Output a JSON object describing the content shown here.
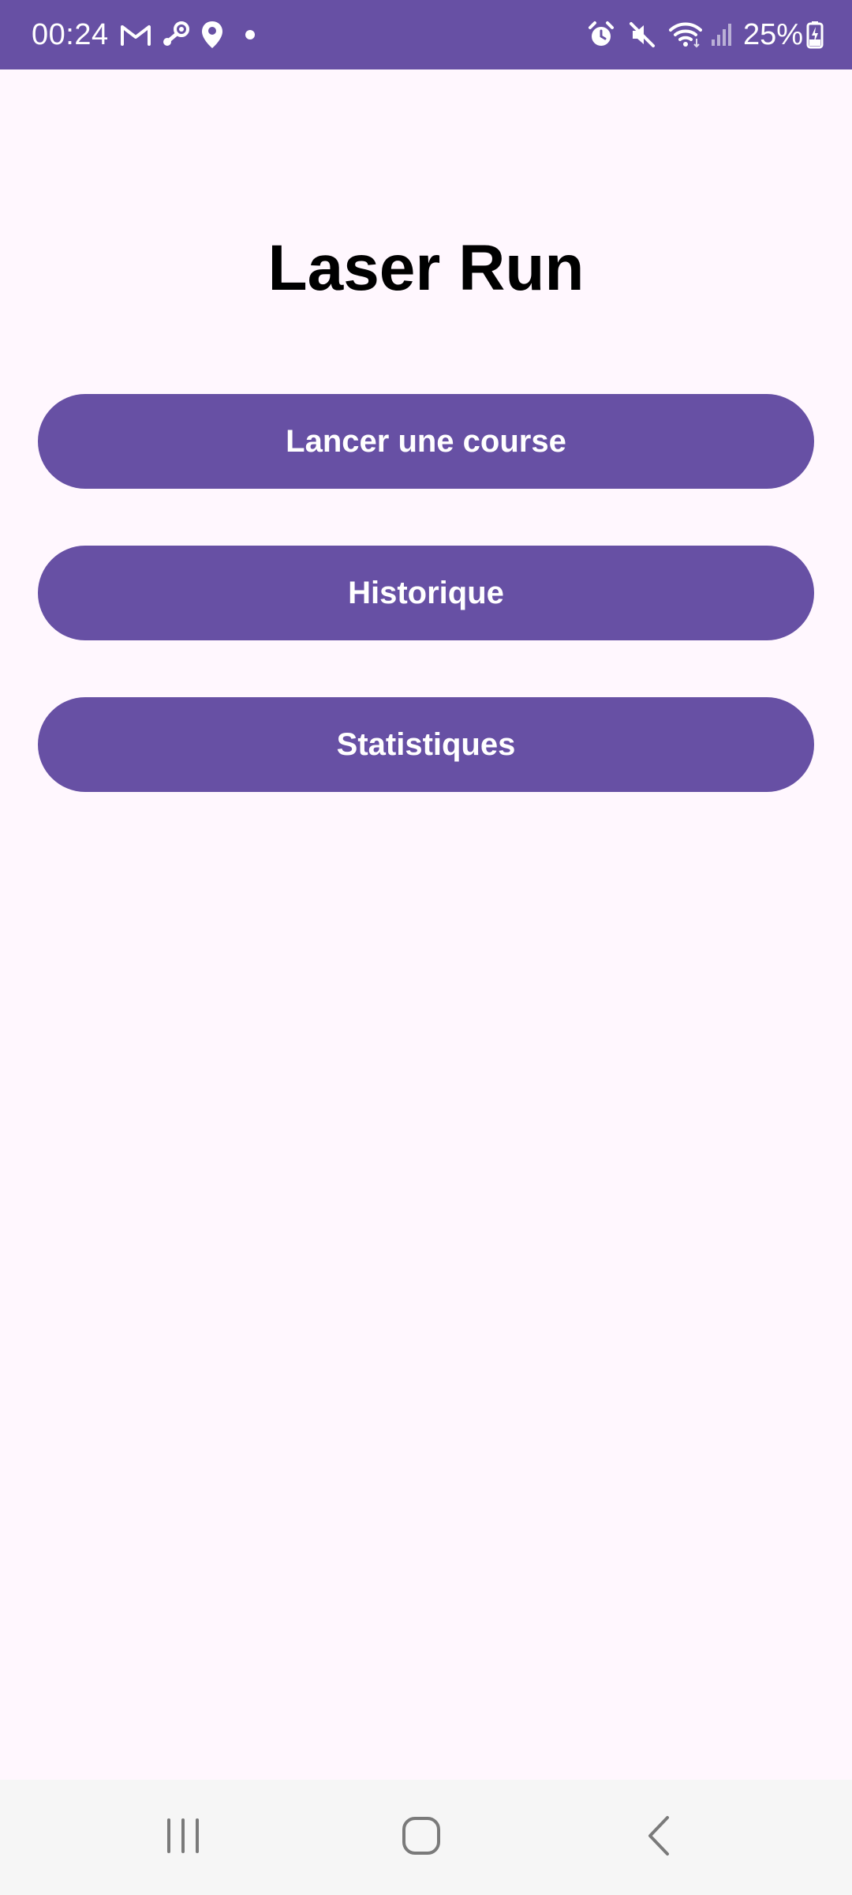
{
  "status_bar": {
    "time": "00:24",
    "battery_percent": "25%",
    "background_color": "#6750A4",
    "left_icons": [
      "gmail-icon",
      "steam-icon",
      "location-pin-icon",
      "notification-dot-icon"
    ],
    "right_icons": [
      "alarm-icon",
      "mute-icon",
      "wifi-icon",
      "cellular-signal-icon",
      "battery-charging-icon"
    ]
  },
  "app": {
    "title": "Laser Run",
    "background_color": "#FFF7FE",
    "accent_color": "#6750A4"
  },
  "menu": {
    "buttons": [
      {
        "label": "Lancer une course"
      },
      {
        "label": "Historique"
      },
      {
        "label": "Statistiques"
      }
    ]
  },
  "nav_bar": {
    "icons": [
      "recents-icon",
      "home-icon",
      "back-icon"
    ]
  }
}
